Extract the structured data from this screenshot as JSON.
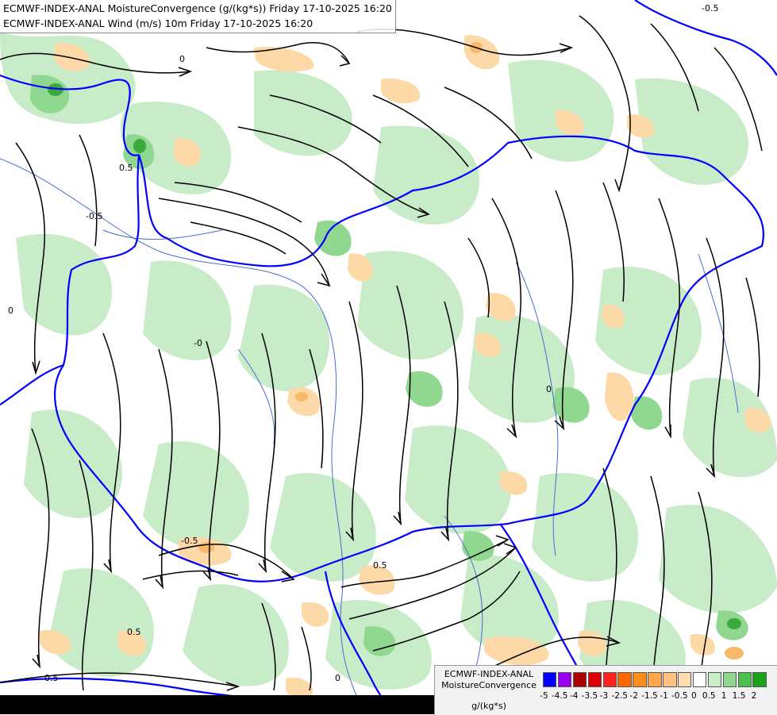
{
  "title": {
    "line1": "ECMWF-INDEX-ANAL MoistureConvergence (g/(kg*s)) Friday 17-10-2025 16:20",
    "line2": "ECMWF-INDEX-ANAL Wind (m/s) 10m Friday 17-10-2025 16:20"
  },
  "legend": {
    "title": "ECMWF-INDEX-ANAL MoistureConvergence",
    "unit": "g/(kg*s)",
    "levels": [
      "-5",
      "-4.5",
      "-4",
      "-3.5",
      "-3",
      "-2.5",
      "-2",
      "-1.5",
      "-1",
      "-0.5",
      "0",
      "0.5",
      "1",
      "1.5",
      "2"
    ],
    "colors": [
      "#0000ff",
      "#9900ee",
      "#aa0000",
      "#dd0000",
      "#ff2020",
      "#ff6600",
      "#ff8c1a",
      "#ffa64d",
      "#ffc080",
      "#ffdcb0",
      "#ffffff",
      "#c8ebc8",
      "#90d890",
      "#4cbf4c",
      "#1aa01a"
    ]
  },
  "map": {
    "colors": {
      "background": "#ffffff",
      "green_light": "#c8ebc8",
      "green_mid": "#90d890",
      "green_dark": "#3aaa3a",
      "orange_light": "#fcd9a6",
      "orange_mid": "#f9b96a",
      "border": "#0000ff",
      "river": "#4a6cd4",
      "streamline": "#000000"
    },
    "contour_labels": [
      "0",
      "-0.5",
      "0.5",
      "-0",
      "0.5",
      "0.5",
      "0",
      "0",
      "-0.5",
      "0",
      "-0.5",
      "0.5"
    ]
  }
}
